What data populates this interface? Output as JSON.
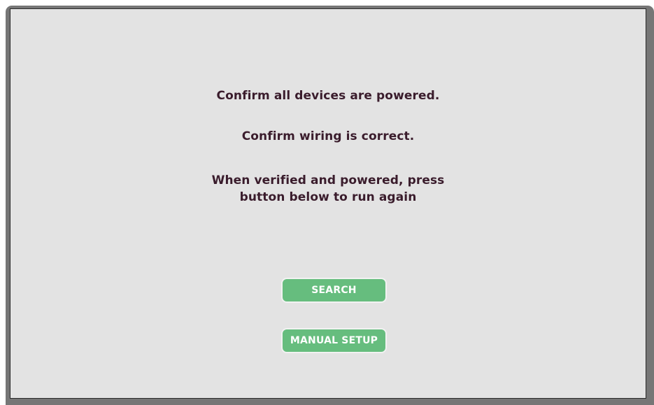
{
  "messages": {
    "line1": "Confirm all devices are powered.",
    "line2": "Confirm wiring is correct.",
    "line3a": "When verified and powered, press",
    "line3b": "button below to run again"
  },
  "buttons": {
    "search_label": "SEARCH",
    "manual_setup_label": "MANUAL SETUP"
  },
  "colors": {
    "button_fill": "#66bd7e",
    "screen_background": "#e3e3e3",
    "text": "#3a1c2c",
    "bezel": "#767676"
  }
}
